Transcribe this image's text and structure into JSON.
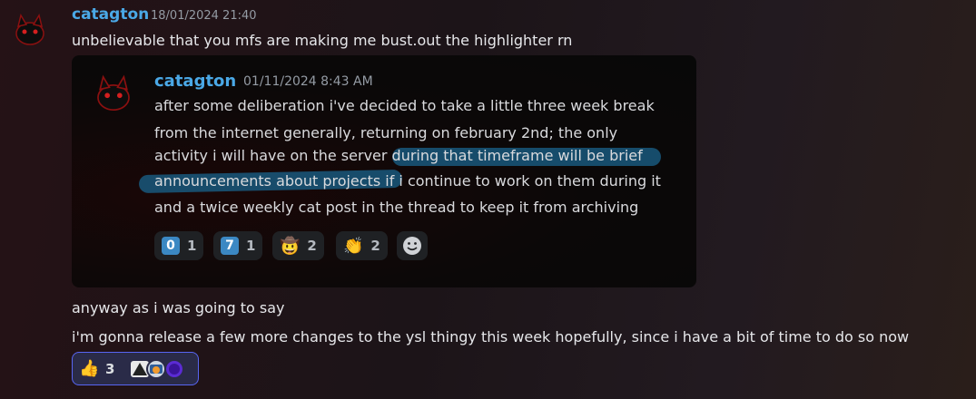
{
  "message": {
    "username": "catagton",
    "timestamp": "18/01/2024 21:40",
    "text": "unbelievable that you mfs are making me bust.out the highlighter rn"
  },
  "embed": {
    "username": "catagton",
    "timestamp": "01/11/2024 8:43 AM",
    "lines": [
      "after some deliberation i've decided to take a little three week break",
      "from the internet generally, returning on february 2nd; the only",
      "activity i will have on the server during that timeframe will be brief",
      "announcements about projects if i continue to work on them during it",
      "and a twice weekly cat post in the thread to keep it from archiving"
    ],
    "reactions": [
      {
        "icon": "keycap-zero-icon",
        "emoji": "0",
        "count": "1"
      },
      {
        "icon": "keycap-seven-icon",
        "emoji": "7",
        "count": "1"
      },
      {
        "icon": "cowboy-face-icon",
        "emoji": "🤠",
        "count": "2"
      },
      {
        "icon": "clapping-hands-icon",
        "emoji": "👏",
        "count": "2"
      }
    ]
  },
  "followups": [
    "anyway as i was going to say",
    "i'm gonna release a few more changes to the ysl thingy this week hopefully, since i have a bit of time to do so now"
  ],
  "bottom_reaction": {
    "emoji": "👍",
    "count": "3"
  },
  "colors": {
    "username": "#4aa8e6",
    "highlight": "#19587d",
    "reaction_border": "#5865f2"
  }
}
